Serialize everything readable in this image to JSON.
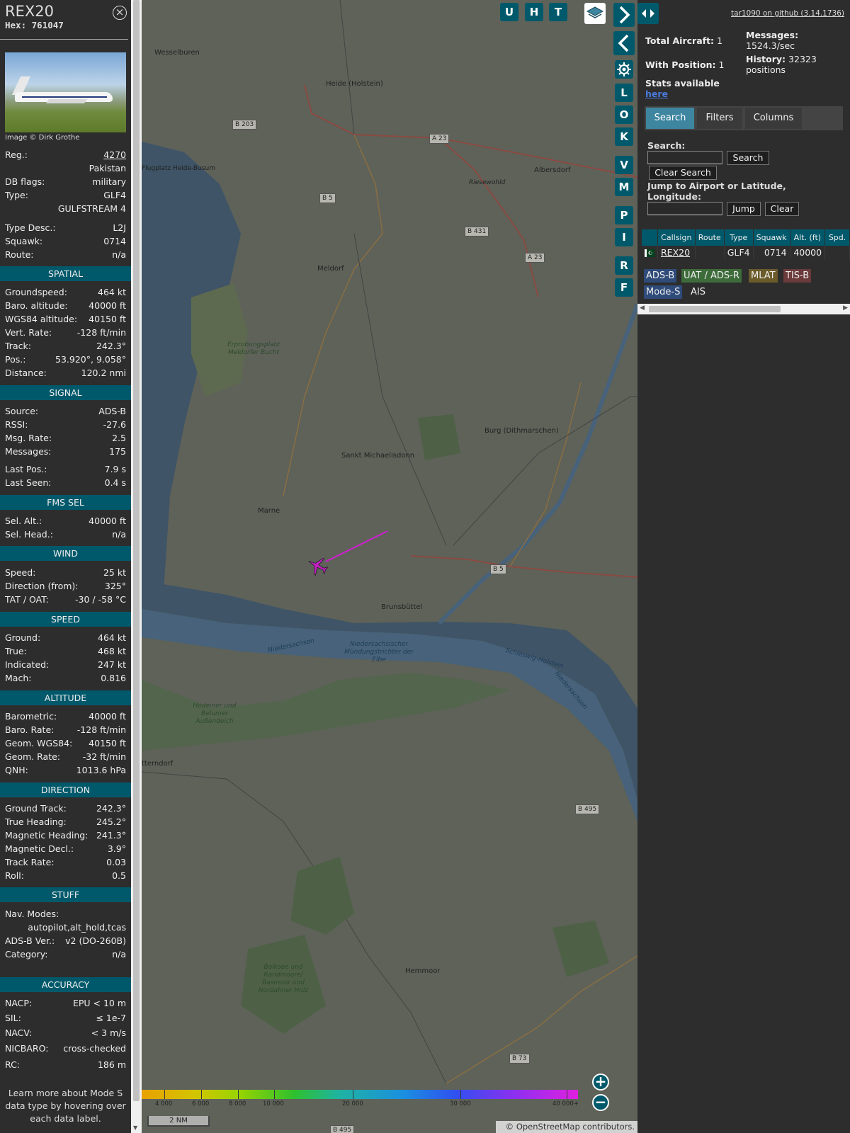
{
  "sidebar": {
    "title": "REX20",
    "hex_label": "Hex:",
    "hex_value": "761047",
    "photo_credit": "Image © Dirk Grothe",
    "details": [
      {
        "label": "Reg.:",
        "value": "4270"
      },
      {
        "label": "",
        "value": "Pakistan"
      },
      {
        "label": "DB flags:",
        "value": "military"
      },
      {
        "label": "Type:",
        "value": "GLF4"
      },
      {
        "label": "",
        "value": "GULFSTREAM 4"
      },
      {
        "label": "Type Desc.:",
        "value": "L2J"
      },
      {
        "label": "Squawk:",
        "value": "0714"
      },
      {
        "label": "Route:",
        "value": "n/a"
      }
    ],
    "sections": {
      "spatial": "SPATIAL",
      "signal": "SIGNAL",
      "fms": "FMS SEL",
      "wind": "WIND",
      "speed": "SPEED",
      "altitude": "ALTITUDE",
      "direction": "DIRECTION",
      "stuff": "STUFF",
      "accuracy": "ACCURACY"
    },
    "spatial": [
      {
        "label": "Groundspeed:",
        "value": "464 kt"
      },
      {
        "label": "Baro. altitude:",
        "value": "40000 ft"
      },
      {
        "label": "WGS84 altitude:",
        "value": "40150 ft"
      },
      {
        "label": "Vert. Rate:",
        "value": "-128 ft/min"
      },
      {
        "label": "Track:",
        "value": "242.3°"
      },
      {
        "label": "Pos.:",
        "value": "53.920°, 9.058°"
      },
      {
        "label": "Distance:",
        "value": "120.2 nmi"
      }
    ],
    "signal": [
      {
        "label": "Source:",
        "value": "ADS-B"
      },
      {
        "label": "RSSI:",
        "value": "-27.6"
      },
      {
        "label": "Msg. Rate:",
        "value": "2.5"
      },
      {
        "label": "Messages:",
        "value": "175"
      },
      {
        "label": "Last Pos.:",
        "value": "7.9 s"
      },
      {
        "label": "Last Seen:",
        "value": "0.4 s"
      }
    ],
    "fms": [
      {
        "label": "Sel. Alt.:",
        "value": "40000 ft"
      },
      {
        "label": "Sel. Head.:",
        "value": "n/a"
      }
    ],
    "wind": [
      {
        "label": "Speed:",
        "value": "25 kt"
      },
      {
        "label": "Direction (from):",
        "value": "325°"
      },
      {
        "label": "TAT / OAT:",
        "value": "-30 / -58 °C"
      }
    ],
    "speed": [
      {
        "label": "Ground:",
        "value": "464 kt"
      },
      {
        "label": "True:",
        "value": "468 kt"
      },
      {
        "label": "Indicated:",
        "value": "247 kt"
      },
      {
        "label": "Mach:",
        "value": "0.816"
      }
    ],
    "altitude": [
      {
        "label": "Barometric:",
        "value": "40000 ft"
      },
      {
        "label": "Baro. Rate:",
        "value": "-128 ft/min"
      },
      {
        "label": "Geom. WGS84:",
        "value": "40150 ft"
      },
      {
        "label": "Geom. Rate:",
        "value": "-32 ft/min"
      },
      {
        "label": "QNH:",
        "value": "1013.6 hPa"
      }
    ],
    "direction": [
      {
        "label": "Ground Track:",
        "value": "242.3°"
      },
      {
        "label": "True Heading:",
        "value": "245.2°"
      },
      {
        "label": "Magnetic Heading:",
        "value": "241.3°"
      },
      {
        "label": "Magnetic Decl.:",
        "value": "3.9°"
      },
      {
        "label": "Track Rate:",
        "value": "0.03"
      },
      {
        "label": "Roll:",
        "value": "0.5"
      }
    ],
    "stuff": {
      "nav_modes_label": "Nav. Modes:",
      "nav_modes_value": "autopilot,alt_hold,tcas",
      "adsb_ver_label": "ADS-B Ver.:",
      "adsb_ver_value": "v2 (DO-260B)",
      "category_label": "Category:",
      "category_value": "n/a"
    },
    "accuracy": [
      {
        "label": "NACP:",
        "value": "EPU < 10 m"
      },
      {
        "label": "SIL:",
        "value": "≤ 1e-7"
      },
      {
        "label": "NACV:",
        "value": "< 3 m/s"
      },
      {
        "label": "NICBARO:",
        "value": "cross-checked"
      },
      {
        "label": "RC:",
        "value": "186 m"
      }
    ],
    "footer": "Learn more about Mode S data type by hovering over each data label."
  },
  "map": {
    "buttons_top": [
      "U",
      "H",
      "T"
    ],
    "buttons_side": [
      "L",
      "O",
      "K",
      "V",
      "M",
      "P",
      "I",
      "R",
      "F"
    ],
    "places": [
      "Wesselburen",
      "Heide (Holstein)",
      "Albersdorf",
      "Riesewohld",
      "Flugplatz Heide-Busum",
      "Meldorf",
      "Erprobungsplatz Meldorfer Bucht",
      "Burg (Dithmarschen)",
      "Sankt Michaelisdonn",
      "Marne",
      "Brunsbüttel",
      "Niedersachsischer Mündungstrichter der Elbe",
      "Niedersachsen",
      "Schleswig-Holstein",
      "Niedersachsen",
      "Hodeiner und Belumer Außendeich",
      "tterndorf",
      "Hemmoor",
      "Balksee und Randmoore/ Basmoor und Nordahner Holz"
    ],
    "roads": [
      "B 203",
      "A 23",
      "B 5",
      "B 431",
      "A 23",
      "B 5",
      "B 495",
      "B 73",
      "B 495"
    ],
    "colorbar_labels": [
      "4 000",
      "6 000",
      "8 000",
      "10 000",
      "20 000",
      "30 000",
      "40 000+"
    ],
    "scale": "2 NM",
    "attribution": "© OpenStreetMap contributors.",
    "zoom_in": "+",
    "zoom_out": "−"
  },
  "right": {
    "github": "tar1090 on github (3.14.1736)",
    "total_aircraft_label": "Total Aircraft:",
    "total_aircraft": "1",
    "with_position_label": "With Position:",
    "with_position": "1",
    "messages_label": "Messages:",
    "messages": "1524.3/sec",
    "history_label": "History:",
    "history": "32323 positions",
    "stats_label": "Stats available",
    "stats_link": "here",
    "tabs": [
      "Search",
      "Filters",
      "Columns"
    ],
    "search_label": "Search:",
    "search_value": "",
    "search_button": "Search",
    "clear_search_button": "Clear Search",
    "jump_label": "Jump to Airport or Latitude, Longitude:",
    "jump_value": "",
    "jump_button": "Jump",
    "clear_button": "Clear",
    "table": {
      "columns": [
        "",
        "Callsign",
        "Route",
        "Type",
        "Squawk",
        "Alt. (ft)",
        "Spd."
      ],
      "rows": [
        {
          "flag": "",
          "callsign": "REX20",
          "route": "",
          "type": "GLF4",
          "squawk": "0714",
          "alt": "40000",
          "spd": ""
        }
      ]
    },
    "legend": [
      {
        "label": "ADS-B",
        "color": "#2f4b7a"
      },
      {
        "label": "UAT / ADS-R",
        "color": "#3d6b3a"
      },
      {
        "label": "MLAT",
        "color": "#6b5b2a"
      },
      {
        "label": "TIS-B",
        "color": "#6b3a3a"
      },
      {
        "label": "Mode-S",
        "color": "#2f4b7a"
      },
      {
        "label": "AIS",
        "color": "#2d2d2d"
      }
    ]
  },
  "colors": {
    "accent": "#00596b",
    "track": "#d21ed2",
    "aircraft": "#c020c0"
  }
}
